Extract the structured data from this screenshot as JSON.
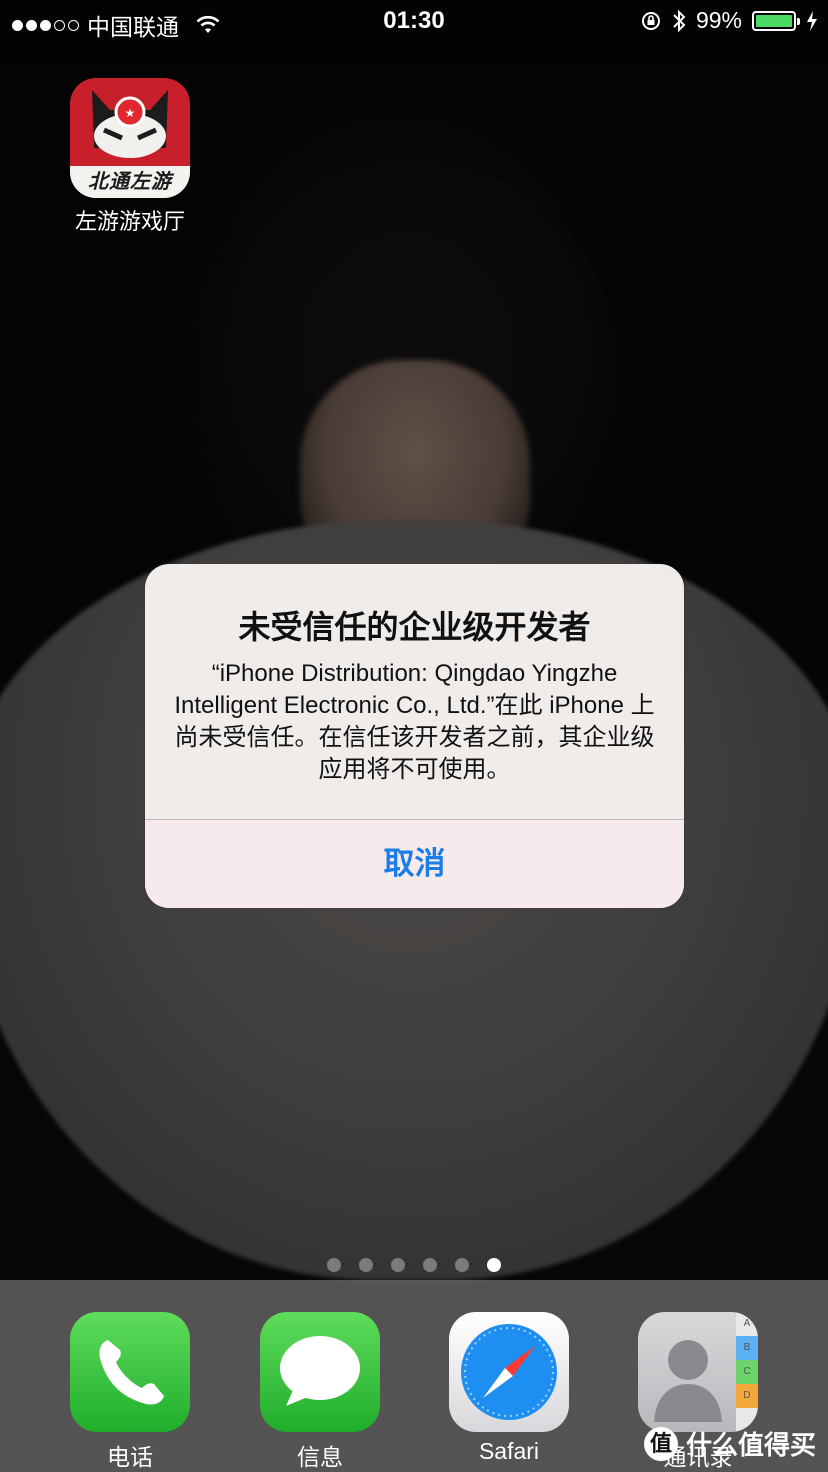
{
  "status_bar": {
    "carrier": "中国联通",
    "time": "01:30",
    "battery_percent": "99%",
    "signal_bars_filled": 3,
    "signal_bars_total": 5,
    "battery_level": 0.99
  },
  "home": {
    "app_icon": {
      "banner_text": "北通左游",
      "label": "左游游戏厅"
    },
    "page_count": 6,
    "active_page": 6
  },
  "alert": {
    "title": "未受信任的企业级开发者",
    "message": "“iPhone Distribution: Qingdao Yingzhe Intelligent Electronic Co., Ltd.”在此 iPhone 上尚未受信任。在信任该开发者之前，其企业级应用将不可使用。",
    "cancel_label": "取消",
    "accent_color": "#1a7ee8"
  },
  "dock": {
    "items": [
      {
        "label": "电话",
        "icon": "phone-icon"
      },
      {
        "label": "信息",
        "icon": "messages-icon"
      },
      {
        "label": "Safari",
        "icon": "safari-icon"
      },
      {
        "label": "通讯录",
        "icon": "contacts-icon"
      }
    ],
    "contacts_tabs": [
      "A",
      "B",
      "C",
      "D"
    ]
  },
  "watermark": {
    "badge": "值",
    "text": "什么值得买"
  }
}
